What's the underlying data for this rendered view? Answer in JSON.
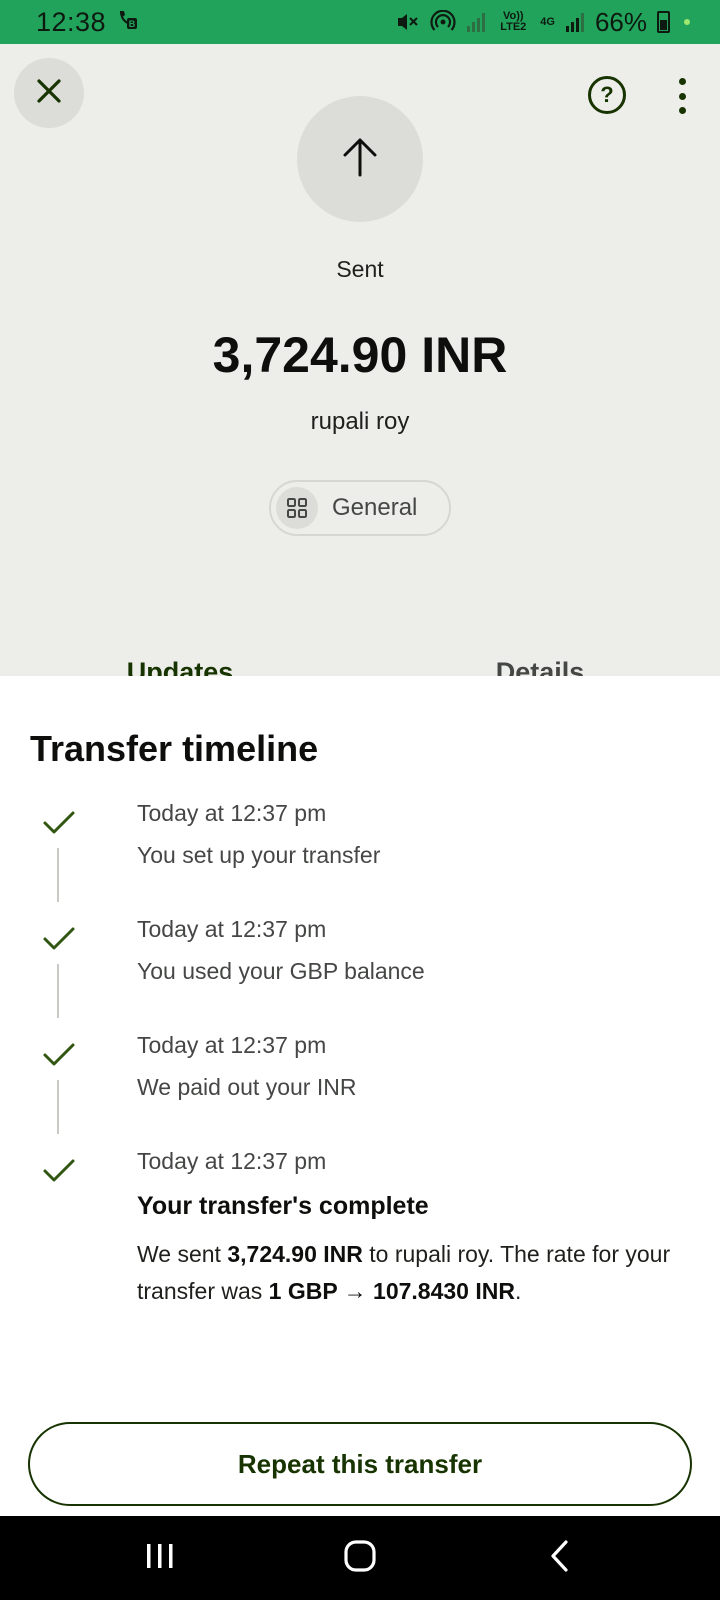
{
  "status_bar": {
    "time": "12:38",
    "battery_percent": "66%",
    "network_label": "4G",
    "volte_label": "Vo)) LTE2",
    "icons": [
      "whatsapp-business-icon",
      "mute-icon",
      "hotspot-icon",
      "signal-icon",
      "volte-icon",
      "4g-icon",
      "battery-icon"
    ]
  },
  "header": {
    "close_icon": "close-icon",
    "help_icon": "help-icon",
    "more_icon": "more-vertical-icon",
    "status_icon": "arrow-up-icon",
    "status_label": "Sent",
    "amount": "3,724.90 INR",
    "recipient": "rupali roy",
    "category": {
      "icon": "grid-icon",
      "label": "General"
    }
  },
  "tabs": [
    {
      "label": "Updates",
      "active": true
    },
    {
      "label": "Details",
      "active": false
    }
  ],
  "timeline": {
    "title": "Transfer timeline",
    "items": [
      {
        "time": "Today at 12:37 pm",
        "description": "You set up your transfer"
      },
      {
        "time": "Today at 12:37 pm",
        "description": "You used your GBP balance"
      },
      {
        "time": "Today at 12:37 pm",
        "description": "We paid out your INR"
      },
      {
        "time": "Today at 12:37 pm",
        "heading": "Your transfer's complete",
        "body": {
          "part1": "We sent ",
          "amount": "3,724.90 INR",
          "part2": " to rupali roy. The rate for your transfer was ",
          "rate": "1 GBP → 107.8430 INR",
          "part3": "."
        }
      }
    ]
  },
  "actions": {
    "repeat_label": "Repeat this transfer"
  },
  "colors": {
    "status_bar": "#21a35c",
    "header_bg": "#ededea",
    "accent": "#163300",
    "check": "#2f5711"
  },
  "nav": {
    "icons": [
      "recent-apps-icon",
      "home-icon",
      "back-icon"
    ]
  }
}
